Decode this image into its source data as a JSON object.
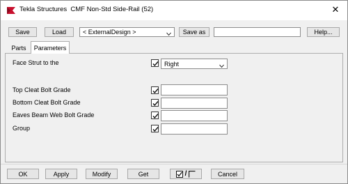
{
  "window": {
    "title_app": "Tekla Structures",
    "title_component": "CMF Non-Std Side-Rail (52)",
    "close_glyph": "✕",
    "accent_color": "#c8102e"
  },
  "toolbar": {
    "save_label": "Save",
    "load_label": "Load",
    "attribute_file_value": "< ExternalDesign >",
    "save_as_label": "Save as",
    "save_as_value": "",
    "help_label": "Help..."
  },
  "tabs": [
    {
      "label": "Parts",
      "active": false
    },
    {
      "label": "Parameters",
      "active": true
    }
  ],
  "parameters": {
    "face_strut": {
      "label": "Face Strut to the",
      "checked": true,
      "value": "Right"
    },
    "top_cleat_bolt_grade": {
      "label": "Top Cleat Bolt Grade",
      "checked": true,
      "value": ""
    },
    "bottom_cleat_bolt_grade": {
      "label": "Bottom Cleat Bolt Grade",
      "checked": true,
      "value": ""
    },
    "eaves_beam_web_bolt_grade": {
      "label": "Eaves Beam Web Bolt Grade",
      "checked": true,
      "value": ""
    },
    "group": {
      "label": "Group",
      "checked": true,
      "value": ""
    }
  },
  "footer": {
    "ok_label": "OK",
    "apply_label": "Apply",
    "modify_label": "Modify",
    "get_label": "Get",
    "toggle_separator": "/",
    "cancel_label": "Cancel"
  }
}
